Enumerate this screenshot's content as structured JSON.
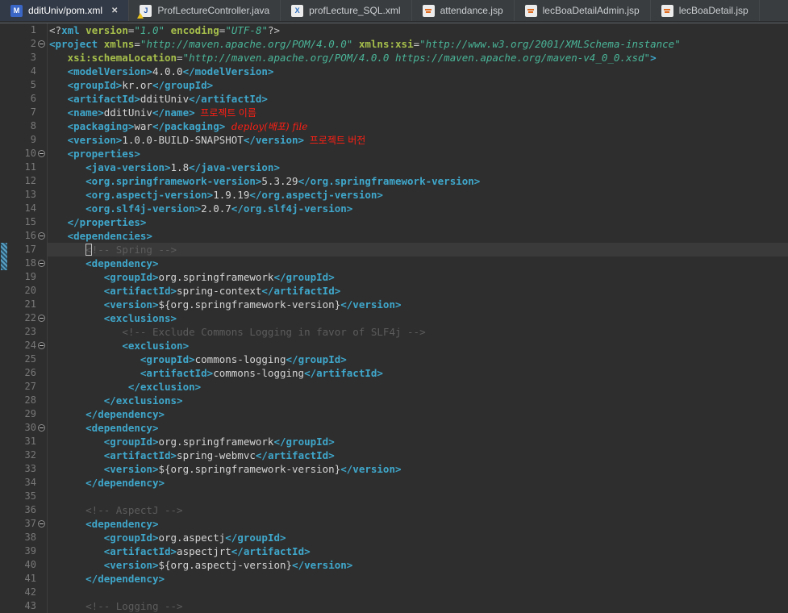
{
  "colors": {
    "editor_bg": "#2e2e2e",
    "current_line_bg": "#3a3a3a",
    "gutter_fg": "#787878",
    "tabbar_bg": "#3a3d3f",
    "tab_active_bg": "#323a47",
    "tab_fg": "#cdd0d3",
    "tab_active_fg": "#ffffff",
    "tag": "#3fa7cb",
    "attr": "#a6bf4b",
    "value": "#4ab598",
    "text": "#d4d4d4",
    "comment": "#5c5c5c",
    "decl": "#c8c8c8",
    "annotation_red": "#ff1f14",
    "ruler_marker_a": "#57a0c4",
    "ruler_marker_b": "#2d546b"
  },
  "tabs": [
    {
      "label": "dditUniv/pom.xml",
      "icon": "maven-pom",
      "active": true,
      "close_glyph": "✕"
    },
    {
      "label": "ProfLectureController.java",
      "icon": "java-warning",
      "active": false
    },
    {
      "label": "profLecture_SQL.xml",
      "icon": "xml-file",
      "active": false
    },
    {
      "label": "attendance.jsp",
      "icon": "jsp-file",
      "active": false
    },
    {
      "label": "lecBoaDetailAdmin.jsp",
      "icon": "jsp-file",
      "active": false
    },
    {
      "label": "lecBoaDetail.jsp",
      "icon": "jsp-file",
      "active": false
    }
  ],
  "editor": {
    "cursor": {
      "line": 17,
      "token": 1
    },
    "folded_lines": [
      2,
      10,
      16,
      18,
      22,
      24,
      30,
      37
    ],
    "range_marker_lines": [
      17,
      18
    ],
    "lines": [
      {
        "num": 1,
        "tokens": [
          [
            "q",
            "<?"
          ],
          [
            "t",
            "xml"
          ],
          [
            "x",
            " "
          ],
          [
            "a",
            "version"
          ],
          [
            "q",
            "="
          ],
          [
            "v",
            "\"1.0\""
          ],
          [
            "x",
            " "
          ],
          [
            "a",
            "encoding"
          ],
          [
            "q",
            "="
          ],
          [
            "v",
            "\"UTF-8\""
          ],
          [
            "q",
            "?>"
          ]
        ]
      },
      {
        "num": 2,
        "tokens": [
          [
            "t",
            "<project"
          ],
          [
            "x",
            " "
          ],
          [
            "a",
            "xmlns"
          ],
          [
            "q",
            "="
          ],
          [
            "v",
            "\"http://maven.apache.org/POM/4.0.0\""
          ],
          [
            "x",
            " "
          ],
          [
            "a",
            "xmlns:xsi"
          ],
          [
            "q",
            "="
          ],
          [
            "v",
            "\"http://www.w3.org/2001/XMLSchema-instance\""
          ]
        ]
      },
      {
        "num": 3,
        "tokens": [
          [
            "x",
            "\t"
          ],
          [
            "a",
            "xsi:schemaLocation"
          ],
          [
            "q",
            "="
          ],
          [
            "v",
            "\"http://maven.apache.org/POM/4.0.0 https://maven.apache.org/maven-v4_0_0.xsd\""
          ],
          [
            "t",
            ">"
          ]
        ]
      },
      {
        "num": 4,
        "tokens": [
          [
            "x",
            "\t"
          ],
          [
            "t",
            "<modelVersion>"
          ],
          [
            "x",
            "4.0.0"
          ],
          [
            "t",
            "</modelVersion>"
          ]
        ]
      },
      {
        "num": 5,
        "tokens": [
          [
            "x",
            "\t"
          ],
          [
            "t",
            "<groupId>"
          ],
          [
            "x",
            "kr.or"
          ],
          [
            "t",
            "</groupId>"
          ]
        ]
      },
      {
        "num": 6,
        "tokens": [
          [
            "x",
            "\t"
          ],
          [
            "t",
            "<artifactId>"
          ],
          [
            "x",
            "dditUniv"
          ],
          [
            "t",
            "</artifactId>"
          ]
        ]
      },
      {
        "num": 7,
        "tokens": [
          [
            "x",
            "\t"
          ],
          [
            "t",
            "<name>"
          ],
          [
            "x",
            "dditUniv"
          ],
          [
            "t",
            "</name>"
          ],
          [
            "r",
            "  프로젝트 이름"
          ]
        ]
      },
      {
        "num": 8,
        "tokens": [
          [
            "x",
            "\t"
          ],
          [
            "t",
            "<packaging>"
          ],
          [
            "x",
            "war"
          ],
          [
            "t",
            "</packaging>"
          ],
          [
            "r2",
            "  deploy(배포) file"
          ]
        ]
      },
      {
        "num": 9,
        "tokens": [
          [
            "x",
            "\t"
          ],
          [
            "t",
            "<version>"
          ],
          [
            "x",
            "1.0.0-BUILD-SNAPSHOT"
          ],
          [
            "t",
            "</version>"
          ],
          [
            "r",
            "  프로젝트 버전"
          ]
        ]
      },
      {
        "num": 10,
        "tokens": [
          [
            "x",
            "\t"
          ],
          [
            "t",
            "<properties>"
          ]
        ]
      },
      {
        "num": 11,
        "tokens": [
          [
            "x",
            "\t\t"
          ],
          [
            "t",
            "<java-version>"
          ],
          [
            "x",
            "1.8"
          ],
          [
            "t",
            "</java-version>"
          ]
        ]
      },
      {
        "num": 12,
        "tokens": [
          [
            "x",
            "\t\t"
          ],
          [
            "t",
            "<org.springframework-version>"
          ],
          [
            "x",
            "5.3.29"
          ],
          [
            "t",
            "</org.springframework-version>"
          ]
        ]
      },
      {
        "num": 13,
        "tokens": [
          [
            "x",
            "\t\t"
          ],
          [
            "t",
            "<org.aspectj-version>"
          ],
          [
            "x",
            "1.9.19"
          ],
          [
            "t",
            "</org.aspectj-version>"
          ]
        ]
      },
      {
        "num": 14,
        "tokens": [
          [
            "x",
            "\t\t"
          ],
          [
            "t",
            "<org.slf4j-version>"
          ],
          [
            "x",
            "2.0.7"
          ],
          [
            "t",
            "</org.slf4j-version>"
          ]
        ]
      },
      {
        "num": 15,
        "tokens": [
          [
            "x",
            "\t"
          ],
          [
            "t",
            "</properties>"
          ]
        ]
      },
      {
        "num": 16,
        "tokens": [
          [
            "x",
            "\t"
          ],
          [
            "t",
            "<dependencies>"
          ]
        ]
      },
      {
        "num": 17,
        "tokens": [
          [
            "x",
            "\t\t"
          ],
          [
            "c",
            "<!-- Spring -->"
          ]
        ]
      },
      {
        "num": 18,
        "tokens": [
          [
            "x",
            "\t\t"
          ],
          [
            "t",
            "<dependency>"
          ]
        ]
      },
      {
        "num": 19,
        "tokens": [
          [
            "x",
            "\t\t\t"
          ],
          [
            "t",
            "<groupId>"
          ],
          [
            "x",
            "org.springframework"
          ],
          [
            "t",
            "</groupId>"
          ]
        ]
      },
      {
        "num": 20,
        "tokens": [
          [
            "x",
            "\t\t\t"
          ],
          [
            "t",
            "<artifactId>"
          ],
          [
            "x",
            "spring-context"
          ],
          [
            "t",
            "</artifactId>"
          ]
        ]
      },
      {
        "num": 21,
        "tokens": [
          [
            "x",
            "\t\t\t"
          ],
          [
            "t",
            "<version>"
          ],
          [
            "x",
            "${org.springframework-version}"
          ],
          [
            "t",
            "</version>"
          ]
        ]
      },
      {
        "num": 22,
        "tokens": [
          [
            "x",
            "\t\t\t"
          ],
          [
            "t",
            "<exclusions>"
          ]
        ]
      },
      {
        "num": 23,
        "tokens": [
          [
            "x",
            "\t\t\t\t"
          ],
          [
            "c",
            "<!-- Exclude Commons Logging in favor of SLF4j -->"
          ]
        ]
      },
      {
        "num": 24,
        "tokens": [
          [
            "x",
            "\t\t\t\t"
          ],
          [
            "t",
            "<exclusion>"
          ]
        ]
      },
      {
        "num": 25,
        "tokens": [
          [
            "x",
            "\t\t\t\t\t"
          ],
          [
            "t",
            "<groupId>"
          ],
          [
            "x",
            "commons-logging"
          ],
          [
            "t",
            "</groupId>"
          ]
        ]
      },
      {
        "num": 26,
        "tokens": [
          [
            "x",
            "\t\t\t\t\t"
          ],
          [
            "t",
            "<artifactId>"
          ],
          [
            "x",
            "commons-logging"
          ],
          [
            "t",
            "</artifactId>"
          ]
        ]
      },
      {
        "num": 27,
        "tokens": [
          [
            "x",
            "\t\t\t\t "
          ],
          [
            "t",
            "</exclusion>"
          ]
        ]
      },
      {
        "num": 28,
        "tokens": [
          [
            "x",
            "\t\t\t"
          ],
          [
            "t",
            "</exclusions>"
          ]
        ]
      },
      {
        "num": 29,
        "tokens": [
          [
            "x",
            "\t\t"
          ],
          [
            "t",
            "</dependency>"
          ]
        ]
      },
      {
        "num": 30,
        "tokens": [
          [
            "x",
            "\t\t"
          ],
          [
            "t",
            "<dependency>"
          ]
        ]
      },
      {
        "num": 31,
        "tokens": [
          [
            "x",
            "\t\t\t"
          ],
          [
            "t",
            "<groupId>"
          ],
          [
            "x",
            "org.springframework"
          ],
          [
            "t",
            "</groupId>"
          ]
        ]
      },
      {
        "num": 32,
        "tokens": [
          [
            "x",
            "\t\t\t"
          ],
          [
            "t",
            "<artifactId>"
          ],
          [
            "x",
            "spring-webmvc"
          ],
          [
            "t",
            "</artifactId>"
          ]
        ]
      },
      {
        "num": 33,
        "tokens": [
          [
            "x",
            "\t\t\t"
          ],
          [
            "t",
            "<version>"
          ],
          [
            "x",
            "${org.springframework-version}"
          ],
          [
            "t",
            "</version>"
          ]
        ]
      },
      {
        "num": 34,
        "tokens": [
          [
            "x",
            "\t\t"
          ],
          [
            "t",
            "</dependency>"
          ]
        ]
      },
      {
        "num": 35,
        "tokens": []
      },
      {
        "num": 36,
        "tokens": [
          [
            "x",
            "\t\t"
          ],
          [
            "c",
            "<!-- AspectJ -->"
          ]
        ]
      },
      {
        "num": 37,
        "tokens": [
          [
            "x",
            "\t\t"
          ],
          [
            "t",
            "<dependency>"
          ]
        ]
      },
      {
        "num": 38,
        "tokens": [
          [
            "x",
            "\t\t\t"
          ],
          [
            "t",
            "<groupId>"
          ],
          [
            "x",
            "org.aspectj"
          ],
          [
            "t",
            "</groupId>"
          ]
        ]
      },
      {
        "num": 39,
        "tokens": [
          [
            "x",
            "\t\t\t"
          ],
          [
            "t",
            "<artifactId>"
          ],
          [
            "x",
            "aspectjrt"
          ],
          [
            "t",
            "</artifactId>"
          ]
        ]
      },
      {
        "num": 40,
        "tokens": [
          [
            "x",
            "\t\t\t"
          ],
          [
            "t",
            "<version>"
          ],
          [
            "x",
            "${org.aspectj-version}"
          ],
          [
            "t",
            "</version>"
          ]
        ]
      },
      {
        "num": 41,
        "tokens": [
          [
            "x",
            "\t\t"
          ],
          [
            "t",
            "</dependency>"
          ]
        ]
      },
      {
        "num": 42,
        "tokens": []
      },
      {
        "num": 43,
        "tokens": [
          [
            "x",
            "\t\t"
          ],
          [
            "c",
            "<!-- Logging -->"
          ]
        ]
      }
    ]
  }
}
